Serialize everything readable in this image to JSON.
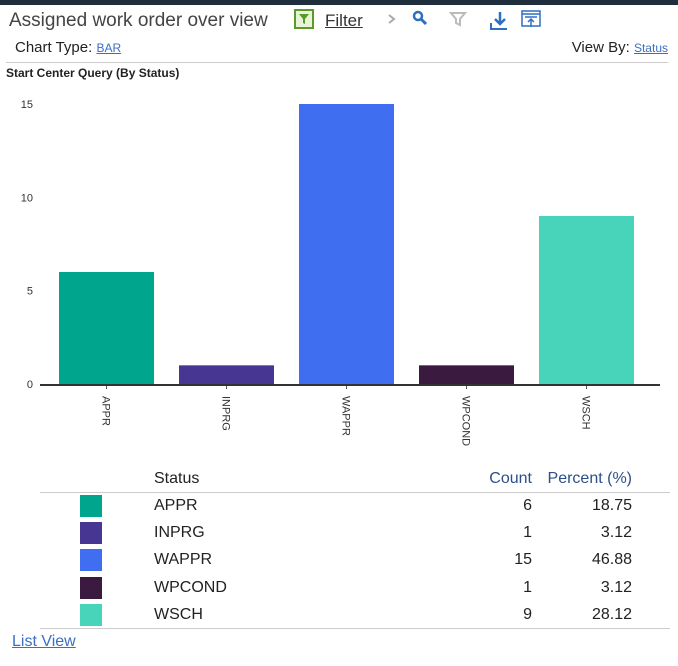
{
  "header": {
    "title": "Assigned work order over view",
    "filter_label": "Filter",
    "chart_type_label": "Chart Type:",
    "chart_type_value": "BAR",
    "view_by_label": "View By:",
    "view_by_value": "Status"
  },
  "chart_data": {
    "type": "bar",
    "title": "Start Center Query (By Status)",
    "categories": [
      "APPR",
      "INPRG",
      "WAPPR",
      "WPCOND",
      "WSCH"
    ],
    "values": [
      6,
      1,
      15,
      1,
      9
    ],
    "colors": [
      "#00a58e",
      "#473793",
      "#3f6ff0",
      "#3b1a3f",
      "#48d4bb"
    ],
    "yticks": [
      0,
      5,
      10,
      15
    ],
    "ylim": [
      0,
      15
    ],
    "xlabel": "",
    "ylabel": ""
  },
  "table": {
    "headers": {
      "status": "Status",
      "count": "Count",
      "percent": "Percent (%)"
    },
    "rows": [
      {
        "status": "APPR",
        "count": "6",
        "percent": "18.75"
      },
      {
        "status": "INPRG",
        "count": "1",
        "percent": "3.12"
      },
      {
        "status": "WAPPR",
        "count": "15",
        "percent": "46.88"
      },
      {
        "status": "WPCOND",
        "count": "1",
        "percent": "3.12"
      },
      {
        "status": "WSCH",
        "count": "9",
        "percent": "28.12"
      }
    ]
  },
  "footer": {
    "list_view": "List View"
  }
}
